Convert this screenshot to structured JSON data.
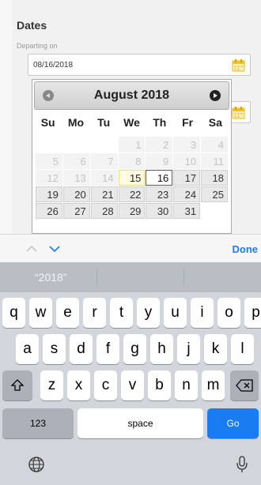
{
  "form": {
    "section_title": "Dates",
    "departing_label": "Departing on",
    "departing_value": "08/16/2018"
  },
  "calendar": {
    "month_title": "August 2018",
    "weekdays": [
      "Su",
      "Mo",
      "Tu",
      "We",
      "Th",
      "Fr",
      "Sa"
    ],
    "weeks": [
      [
        {
          "d": "",
          "s": "empty"
        },
        {
          "d": "",
          "s": "empty"
        },
        {
          "d": "",
          "s": "empty"
        },
        {
          "d": "1",
          "s": "disabled"
        },
        {
          "d": "2",
          "s": "disabled"
        },
        {
          "d": "3",
          "s": "disabled"
        },
        {
          "d": "4",
          "s": "disabled"
        }
      ],
      [
        {
          "d": "5",
          "s": "disabled"
        },
        {
          "d": "6",
          "s": "disabled"
        },
        {
          "d": "7",
          "s": "disabled"
        },
        {
          "d": "8",
          "s": "disabled"
        },
        {
          "d": "9",
          "s": "disabled"
        },
        {
          "d": "10",
          "s": "disabled"
        },
        {
          "d": "11",
          "s": "disabled"
        }
      ],
      [
        {
          "d": "12",
          "s": "disabled"
        },
        {
          "d": "13",
          "s": "disabled"
        },
        {
          "d": "14",
          "s": "disabled"
        },
        {
          "d": "15",
          "s": "today"
        },
        {
          "d": "16",
          "s": "selected"
        },
        {
          "d": "17",
          "s": "active"
        },
        {
          "d": "18",
          "s": "active"
        }
      ],
      [
        {
          "d": "19",
          "s": "active"
        },
        {
          "d": "20",
          "s": "active"
        },
        {
          "d": "21",
          "s": "active"
        },
        {
          "d": "22",
          "s": "active"
        },
        {
          "d": "23",
          "s": "active"
        },
        {
          "d": "24",
          "s": "active"
        },
        {
          "d": "25",
          "s": "active"
        }
      ],
      [
        {
          "d": "26",
          "s": "active"
        },
        {
          "d": "27",
          "s": "active"
        },
        {
          "d": "28",
          "s": "active"
        },
        {
          "d": "29",
          "s": "active"
        },
        {
          "d": "30",
          "s": "active"
        },
        {
          "d": "31",
          "s": "active"
        },
        {
          "d": "",
          "s": "empty"
        }
      ]
    ]
  },
  "accessory": {
    "done_label": "Done"
  },
  "keyboard": {
    "suggestion": "“2018”",
    "row1": [
      "q",
      "w",
      "e",
      "r",
      "t",
      "y",
      "u",
      "i",
      "o",
      "p"
    ],
    "row2": [
      "a",
      "s",
      "d",
      "f",
      "g",
      "h",
      "j",
      "k",
      "l"
    ],
    "row3": [
      "z",
      "x",
      "c",
      "v",
      "b",
      "n",
      "m"
    ],
    "numbers_label": "123",
    "space_label": "space",
    "go_label": "Go"
  },
  "colors": {
    "accent": "#1a7cf2",
    "calendar_icon": "#f2c12e"
  }
}
